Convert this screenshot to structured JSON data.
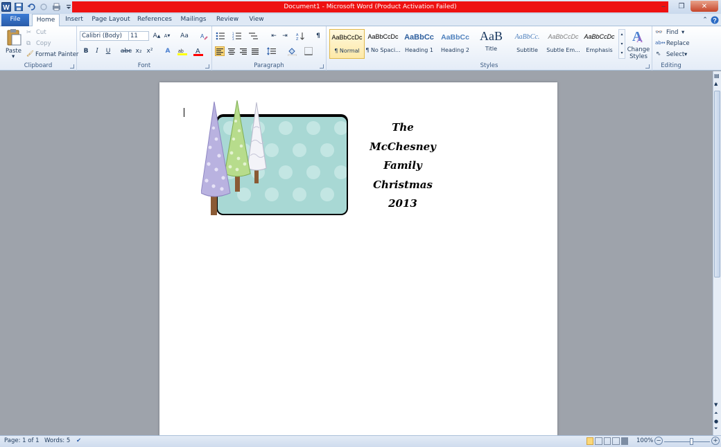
{
  "window": {
    "title": "Document1 - Microsoft Word (Product Activation Failed)",
    "title_bar_color": "#ee1111"
  },
  "quick_access": [
    {
      "icon": "word-logo-icon"
    },
    {
      "icon": "save-icon"
    },
    {
      "icon": "undo-icon"
    },
    {
      "icon": "redo-icon"
    },
    {
      "icon": "print-icon"
    },
    {
      "icon": "customize-qat-icon"
    }
  ],
  "tabs": {
    "file": "File",
    "home": "Home",
    "insert": "Insert",
    "page_layout": "Page Layout",
    "references": "References",
    "mailings": "Mailings",
    "review": "Review",
    "view": "View",
    "active": "Home"
  },
  "clipboard": {
    "paste": "Paste",
    "cut": "Cut",
    "copy": "Copy",
    "format_painter": "Format Painter",
    "label": "Clipboard"
  },
  "font": {
    "name": "Calibri (Body)",
    "size": "11",
    "change_case": "Aa",
    "bold": "B",
    "italic": "I",
    "underline": "U",
    "strike": "abc",
    "subscript": "x₂",
    "superscript": "x²",
    "label": "Font",
    "highlight_color": "#ffff00",
    "font_color": "#ff0000"
  },
  "paragraph": {
    "label": "Paragraph",
    "pilcrow": "¶"
  },
  "styles": {
    "label": "Styles",
    "items": [
      {
        "preview": "AaBbCcDc",
        "name": "¶ Normal"
      },
      {
        "preview": "AaBbCcDc",
        "name": "¶ No Spaci..."
      },
      {
        "preview": "AaBbCc",
        "name": "Heading 1"
      },
      {
        "preview": "AaBbCc",
        "name": "Heading 2"
      },
      {
        "preview": "AaB",
        "name": "Title"
      },
      {
        "preview": "AaBbCc.",
        "name": "Subtitle"
      },
      {
        "preview": "AaBbCcDc",
        "name": "Subtle Em..."
      },
      {
        "preview": "AaBbCcDc",
        "name": "Emphasis"
      }
    ],
    "selected": "¶ Normal",
    "change_styles": "Change Styles"
  },
  "editing": {
    "label": "Editing",
    "find": "Find",
    "replace": "Replace",
    "select": "Select"
  },
  "document": {
    "lines": [
      "The",
      "McChesney",
      "Family",
      "Christmas",
      "2013"
    ],
    "image": "christmas-trees-polka-dot-card",
    "card_color": "#a8d8d4"
  },
  "status": {
    "page": "Page: 1 of 1",
    "words": "Words: 5",
    "zoom": "100%",
    "zoom_minus": "−",
    "zoom_plus": "+"
  }
}
